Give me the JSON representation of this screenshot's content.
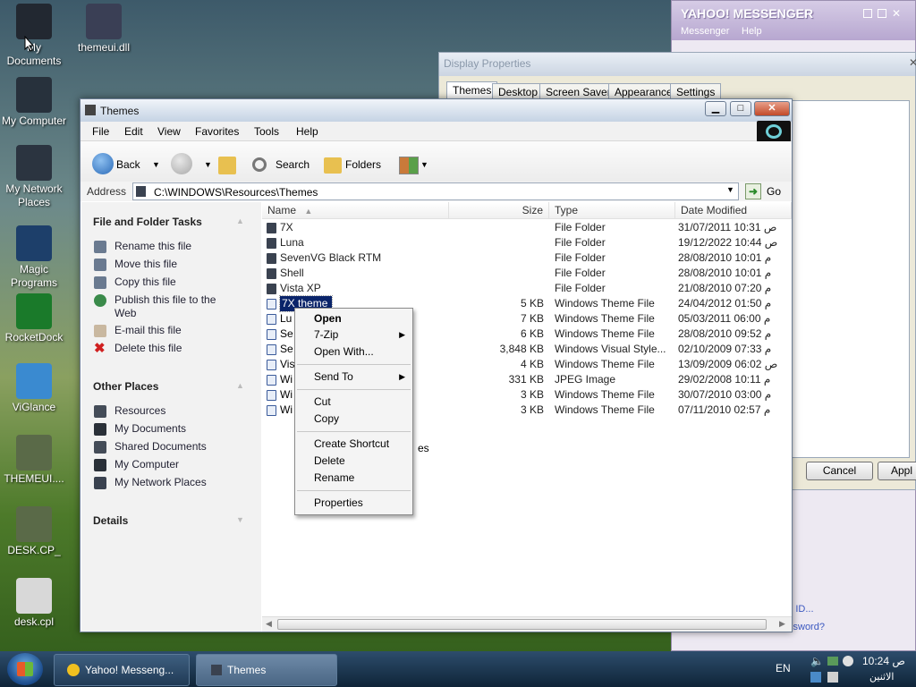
{
  "desktop": {
    "icons": [
      {
        "label": "My Documents",
        "color": "#222831"
      },
      {
        "label": "themeui.dll",
        "color": "#3a3f55"
      },
      {
        "label": "My Computer",
        "color": "#27313c"
      },
      {
        "label": "My Network Places",
        "color": "#2b3440"
      },
      {
        "label": "Magic Programs",
        "color": "#1d3f6a"
      },
      {
        "label": "RocketDock",
        "color": "#1a7a2a"
      },
      {
        "label": "ViGlance",
        "color": "#3a8ad0"
      },
      {
        "label": "THEMEUI....",
        "color": "#5a6a48"
      },
      {
        "label": "DESK.CP_",
        "color": "#5a6a48"
      },
      {
        "label": "desk.cpl",
        "color": "#d8d8d8"
      }
    ]
  },
  "yahoo": {
    "title": "YAHOO! MESSENGER",
    "menu": [
      "Messenger",
      "Help"
    ],
    "links": [
      "oo! ID...",
      "ssword?"
    ]
  },
  "display_properties": {
    "title": "Display Properties",
    "tabs": [
      "Themes",
      "Desktop",
      "Screen Saver",
      "Appearance",
      "Settings"
    ],
    "buttons": {
      "cancel": "Cancel",
      "apply": "Appl"
    }
  },
  "explorer": {
    "title": "Themes",
    "menu": [
      "File",
      "Edit",
      "View",
      "Favorites",
      "Tools",
      "Help"
    ],
    "toolbar": {
      "back": "Back",
      "search": "Search",
      "folders": "Folders"
    },
    "address_label": "Address",
    "address_value": "C:\\WINDOWS\\Resources\\Themes",
    "go": "Go",
    "file_tasks": {
      "header": "File and Folder Tasks",
      "items": [
        "Rename this file",
        "Move this file",
        "Copy this file",
        "Publish this file to the Web",
        "E-mail this file",
        "Delete this file"
      ]
    },
    "other_places": {
      "header": "Other Places",
      "items": [
        "Resources",
        "My Documents",
        "Shared Documents",
        "My Computer",
        "My Network Places"
      ]
    },
    "details_header": "Details",
    "columns": {
      "name": "Name",
      "size": "Size",
      "type": "Type",
      "date": "Date Modified"
    },
    "files": [
      {
        "name": "7X",
        "size": "",
        "type": "File Folder",
        "date": "31/07/2011 10:31 ص"
      },
      {
        "name": "Luna",
        "size": "",
        "type": "File Folder",
        "date": "19/12/2022 10:44 ص"
      },
      {
        "name": "SevenVG Black RTM",
        "size": "",
        "type": "File Folder",
        "date": "28/08/2010 10:01 م"
      },
      {
        "name": "Shell",
        "size": "",
        "type": "File Folder",
        "date": "28/08/2010 10:01 م"
      },
      {
        "name": "Vista XP",
        "size": "",
        "type": "File Folder",
        "date": "21/08/2010 07:20 م"
      },
      {
        "name": "7X theme",
        "size": "5 KB",
        "type": "Windows Theme File",
        "date": "24/04/2012 01:50 م"
      },
      {
        "name": "Lu",
        "size": "7 KB",
        "type": "Windows Theme File",
        "date": "05/03/2011 06:00 م"
      },
      {
        "name": "Se",
        "size": "6 KB",
        "type": "Windows Theme File",
        "date": "28/08/2010 09:52 م"
      },
      {
        "name": "Se",
        "size": "3,848 KB",
        "type": "Windows Visual Style...",
        "date": "02/10/2009 07:33 م"
      },
      {
        "name": "Vis",
        "size": "4 KB",
        "type": "Windows Theme File",
        "date": "13/09/2009 06:02 ص"
      },
      {
        "name": "Wi",
        "size": "331 KB",
        "type": "JPEG Image",
        "date": "29/02/2008 10:11 م"
      },
      {
        "name": "Wi",
        "size": "3 KB",
        "type": "Windows Theme File",
        "date": "30/07/2010 03:00 م"
      },
      {
        "name": "Wi",
        "size": "3 KB",
        "type": "Windows Theme File",
        "date": "07/11/2010 02:57 م"
      }
    ],
    "partial_name_suffix": "es"
  },
  "context_menu": {
    "items": [
      "Open",
      "7-Zip",
      "Open With...",
      "Send To",
      "Cut",
      "Copy",
      "Create Shortcut",
      "Delete",
      "Rename",
      "Properties"
    ]
  },
  "taskbar": {
    "buttons": [
      "Yahoo! Messeng...",
      "Themes"
    ],
    "lang": "EN",
    "time": "ص 10:24",
    "day": "الاثنين"
  }
}
